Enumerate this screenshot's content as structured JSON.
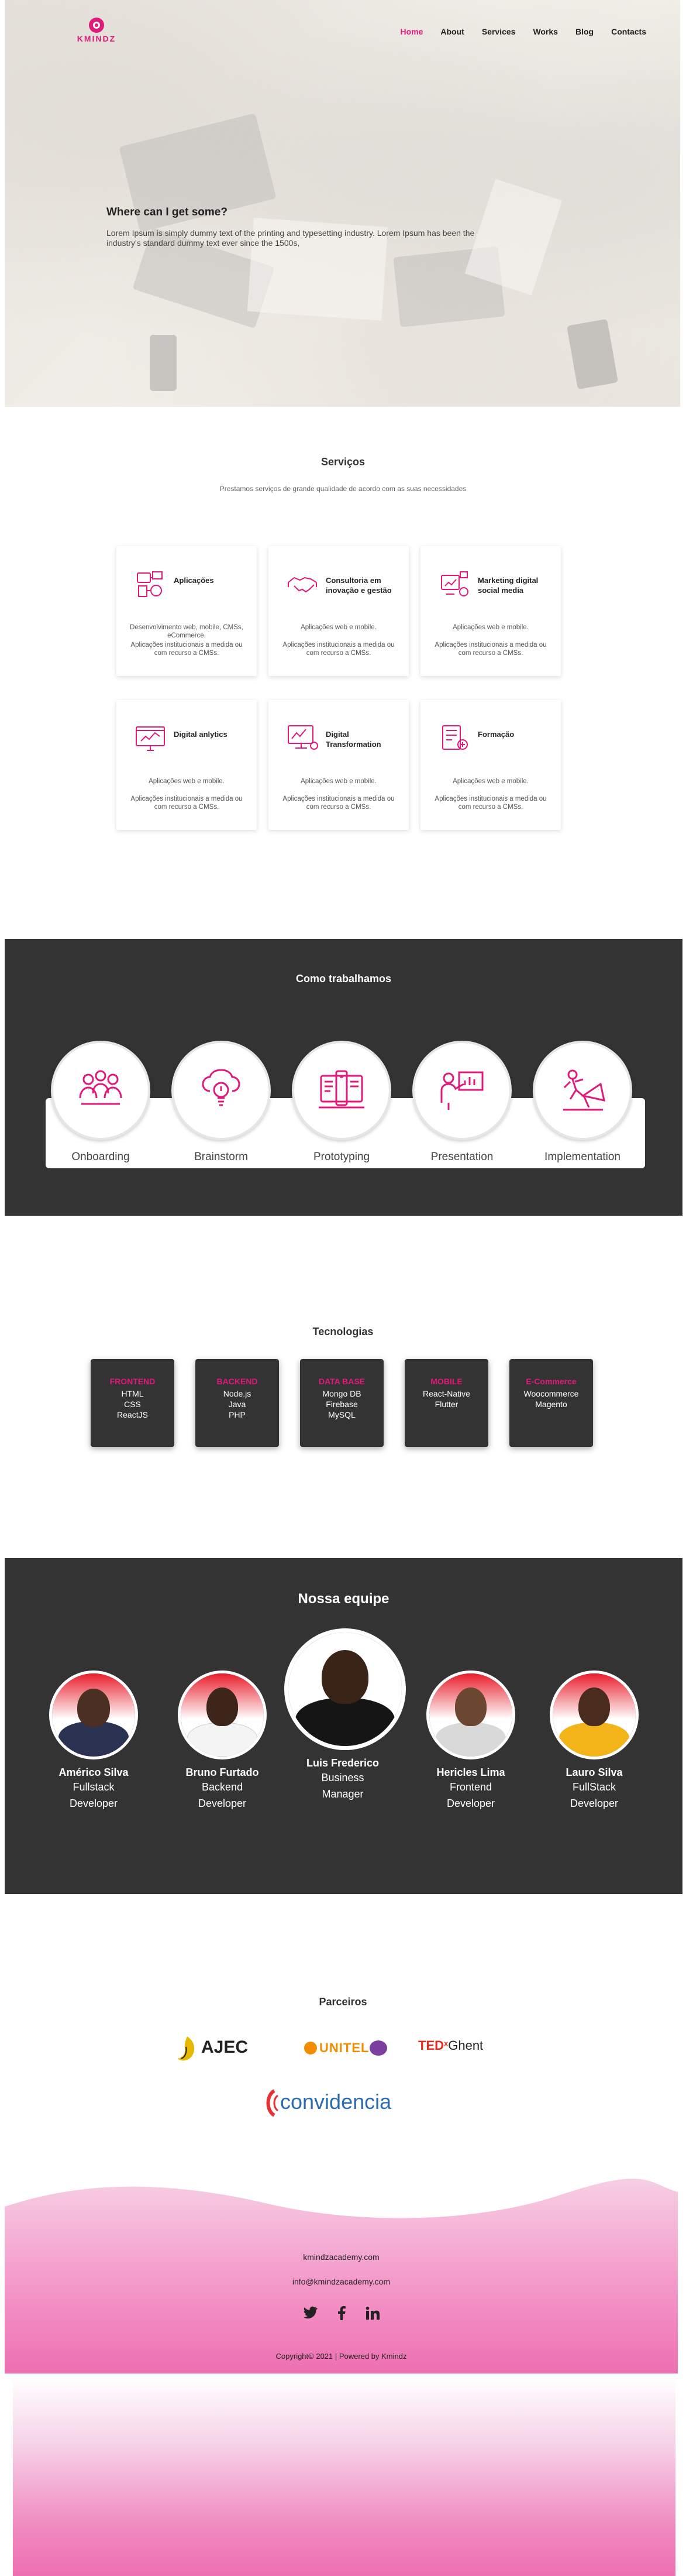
{
  "brand": {
    "name": "KMINDZ",
    "accent": "#e0197a"
  },
  "nav": {
    "items": [
      "Home",
      "About",
      "Services",
      "Works",
      "Blog",
      "Contacts"
    ],
    "active": "Home"
  },
  "hero": {
    "title": "Where can I get some?",
    "text": "Lorem Ipsum is simply dummy text of the printing and typesetting industry. Lorem Ipsum has been the industry's standard dummy text ever since the 1500s,"
  },
  "services": {
    "title": "Serviços",
    "subtitle": "Prestamos serviços de grande qualidade de acordo com as suas necessidades",
    "cards": [
      {
        "title": "Aplicações",
        "icon": "apps-icon",
        "line1": "Desenvolvimento web, mobile, CMSs, eCommerce.",
        "line2": "Aplicações institucionais a medida ou com recurso a CMSs."
      },
      {
        "title": "Consultoria em inovação e gestão",
        "icon": "handshake-icon",
        "line1": "Aplicações web e mobile.",
        "line2": "Aplicações institucionais a medida ou com recurso a CMSs."
      },
      {
        "title": "Marketing digital social media",
        "icon": "marketing-icon",
        "line1": "Aplicações web e mobile.",
        "line2": "Aplicações institucionais a medida ou com recurso a CMSs."
      },
      {
        "title": "Digital anlytics",
        "icon": "analytics-icon",
        "line1": "Aplicações web e mobile.",
        "line2": "Aplicações institucionais a medida ou com recurso a CMSs."
      },
      {
        "title": "Digital Transformation",
        "icon": "transformation-icon",
        "line1": "Aplicações web e mobile.",
        "line2": "Aplicações institucionais a medida ou com recurso a CMSs."
      },
      {
        "title": "Formação",
        "icon": "training-icon",
        "line1": "Aplicações web e mobile.",
        "line2": "Aplicações institucionais a medida ou com recurso a CMSs."
      }
    ]
  },
  "work": {
    "title": "Como trabalhamos",
    "steps": [
      {
        "label": "Onboarding",
        "icon": "team-icon"
      },
      {
        "label": "Brainstorm",
        "icon": "brain-bulb-icon"
      },
      {
        "label": "Prototyping",
        "icon": "prototype-icon"
      },
      {
        "label": "Presentation",
        "icon": "presentation-icon"
      },
      {
        "label": "Implementation",
        "icon": "implementation-icon"
      }
    ]
  },
  "tech": {
    "title": "Tecnologias",
    "cards": [
      {
        "category": "FRONTEND",
        "items": [
          "HTML",
          "CSS",
          "ReactJS"
        ]
      },
      {
        "category": "BACKEND",
        "items": [
          "Node.js",
          "Java",
          "PHP"
        ]
      },
      {
        "category": "DATA BASE",
        "items": [
          "Mongo DB",
          "Firebase",
          "MySQL"
        ]
      },
      {
        "category": "MOBILE",
        "items": [
          "React-Native",
          "Flutter"
        ]
      },
      {
        "category": "E-Commerce",
        "items": [
          "Woocommerce",
          "Magento"
        ]
      }
    ]
  },
  "team": {
    "title": "Nossa equipe",
    "members": [
      {
        "name": "Américo Silva",
        "role1": "Fullstack",
        "role2": "Developer"
      },
      {
        "name": "Bruno Furtado",
        "role1": "Backend",
        "role2": "Developer"
      },
      {
        "name": "Luis Frederico",
        "role1": "Business",
        "role2": "Manager"
      },
      {
        "name": "Hericles Lima",
        "role1": "Frontend",
        "role2": "Developer"
      },
      {
        "name": "Lauro Silva",
        "role1": "FullStack",
        "role2": "Developer"
      }
    ]
  },
  "partners": {
    "title": "Parceiros",
    "logos": [
      {
        "name": "AJEC"
      },
      {
        "name": "UNITEL"
      },
      {
        "name": "TEDxGhent",
        "ted": "TED",
        "x": "x",
        "city": "Ghent"
      },
      {
        "name": "convidencia"
      }
    ]
  },
  "footer": {
    "website": "kmindzacademy.com",
    "email": "info@kmindzacademy.com",
    "socials": [
      "twitter-icon",
      "facebook-icon",
      "linkedin-icon"
    ],
    "copyright": "Copyright© 2021 | Powered by Kmindz"
  }
}
